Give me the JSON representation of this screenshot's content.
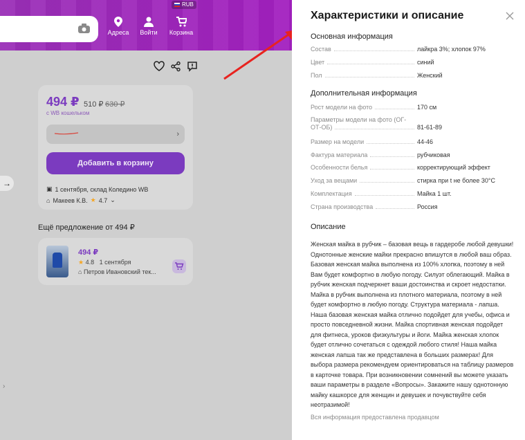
{
  "header": {
    "currency": "RUB",
    "addresses_label": "Адреса",
    "login_label": "Войти",
    "cart_label": "Корзина"
  },
  "product": {
    "price": "494 ₽",
    "price_wallet": "510 ₽",
    "price_old": "630 ₽",
    "wallet_label": "с WB кошельком",
    "add_to_cart": "Добавить в корзину",
    "delivery": "1 сентября, склад Коледино WB",
    "seller": "Макеев К.В.",
    "rating": "4.7"
  },
  "more_offer": {
    "title": "Ещё предложение от 494 ₽",
    "price": "494 ₽",
    "rating": "4.8",
    "date": "1 сентября",
    "seller": "Петров Ивановский тек..."
  },
  "panel": {
    "title": "Характеристики и описание",
    "main_section": "Основная информация",
    "main_specs": [
      {
        "key": "Состав",
        "value": "лайкра 3%; хлопок 97%"
      },
      {
        "key": "Цвет",
        "value": "синий"
      },
      {
        "key": "Пол",
        "value": "Женский"
      }
    ],
    "extra_section": "Дополнительная информация",
    "extra_specs": [
      {
        "key": "Рост модели на фото",
        "value": "170 см"
      },
      {
        "key": "Параметры модели на фото (ОГ-ОТ-ОБ)",
        "value": "81-61-89"
      },
      {
        "key": "Размер на модели",
        "value": "44-46"
      },
      {
        "key": "Фактура материала",
        "value": "рубчиковая"
      },
      {
        "key": "Особенности белья",
        "value": "корректирующий эффект"
      },
      {
        "key": "Уход за вещами",
        "value": "стирка при t не более 30°C"
      },
      {
        "key": "Комплектация",
        "value": "Майка 1 шт."
      },
      {
        "key": "Страна производства",
        "value": "Россия"
      }
    ],
    "description_title": "Описание",
    "description": "Женская майка в рубчик – базовая вещь в гардеробе любой девушки! Однотонные женские майки прекрасно впишутся в любой ваш образ. Базовая женская майка выполнена из 100% хлопка, поэтому в ней Вам будет комфортно в любую погоду. Силуэт облегающий. Майка в рубчик женская подчеркнет ваши достоинства и скроет недостатки. Майка в рубчик выполнена из плотного материала, поэтому в ней будет комфортно в любую погоду. Структура материала - лапша. Наша базовая женская майка отлично подойдет для учебы, офиса и просто повседневной жизни. Майка спортивная женская подойдет для фитнеса, уроков физкультуры и йоги. Майка женская хлопок будет отлично сочетаться с одеждой любого стиля! Наша майка женская лапша так же представлена в больших размерах! Для выбора размера рекомендуем ориентироваться на таблицу размеров в карточке товара. При возникновении сомнений вы можете указать ваши параметры в разделе «Вопросы». Закажите нашу однотонную майку кашкорсе для женщин и девушек и почувствуйте себя неотразимой!",
    "footer": "Вся информация предоставлена продавцом"
  },
  "colors": {
    "brand": "#a31fc0",
    "accent_price": "#7b3bbf",
    "arrow": "#e8231f"
  }
}
